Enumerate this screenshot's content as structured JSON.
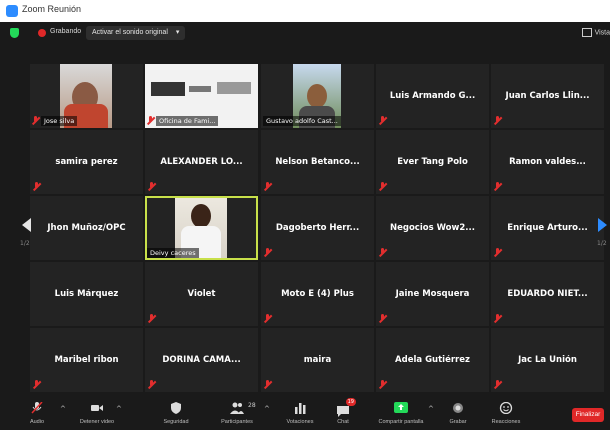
{
  "window": {
    "title": "Zoom Reunión"
  },
  "topbar": {
    "recording_label": "Grabando",
    "original_sound_label": "Activar el sonido original",
    "original_sound_caret": "▾",
    "view_label": "Vista"
  },
  "participants": [
    {
      "name": "Jose silva",
      "video": true,
      "muted": true
    },
    {
      "name": "Oficina de Fami...",
      "video": true,
      "muted": true
    },
    {
      "name": "Gustavo adolfo Cast...",
      "video": true,
      "muted": false
    },
    {
      "name": "Luis Armando G...",
      "video": false,
      "muted": true
    },
    {
      "name": "Juan Carlos Llin...",
      "video": false,
      "muted": true
    },
    {
      "name": "samira perez",
      "video": false,
      "muted": true
    },
    {
      "name": "ALEXANDER LO...",
      "video": false,
      "muted": true
    },
    {
      "name": "Nelson Betanco...",
      "video": false,
      "muted": true
    },
    {
      "name": "Ever Tang Polo",
      "video": false,
      "muted": true
    },
    {
      "name": "Ramon valdes...",
      "video": false,
      "muted": true
    },
    {
      "name": "Jhon Muñoz/OPC",
      "video": false,
      "muted": false
    },
    {
      "name": "Deivy caceres",
      "video": true,
      "muted": false,
      "active_speaker": true
    },
    {
      "name": "Dagoberto Herr...",
      "video": false,
      "muted": true
    },
    {
      "name": "Negocios Wow2...",
      "video": false,
      "muted": true
    },
    {
      "name": "Enrique Arturo...",
      "video": false,
      "muted": true
    },
    {
      "name": "Luis Márquez",
      "video": false,
      "muted": false
    },
    {
      "name": "Violet",
      "video": false,
      "muted": true
    },
    {
      "name": "Moto E (4) Plus",
      "video": false,
      "muted": true
    },
    {
      "name": "Jaine Mosquera",
      "video": false,
      "muted": true
    },
    {
      "name": "EDUARDO NIET...",
      "video": false,
      "muted": true
    },
    {
      "name": "Maribel ribon",
      "video": false,
      "muted": true
    },
    {
      "name": "DORINA CAMA...",
      "video": false,
      "muted": true
    },
    {
      "name": "maira",
      "video": false,
      "muted": true
    },
    {
      "name": "Adela Gutiérrez",
      "video": false,
      "muted": true
    },
    {
      "name": "Jac La Unión",
      "video": false,
      "muted": true
    }
  ],
  "pagination": {
    "left": "1/2",
    "right": "1/2"
  },
  "toolbar": {
    "audio": "Audio",
    "video": "Detener video",
    "security": "Seguridad",
    "participants": "Participantes",
    "participants_count": "28",
    "polls": "Votaciones",
    "chat": "Chat",
    "chat_badge": "19",
    "share": "Compartir pantalla",
    "record": "Grabar",
    "reactions": "Reacciones",
    "end": "Finalizar"
  },
  "colors": {
    "accent": "#2d8cff",
    "mute_red": "#e22e2e",
    "active_border": "#c8e04a",
    "share_green": "#23d959",
    "end_red": "#e02828"
  }
}
